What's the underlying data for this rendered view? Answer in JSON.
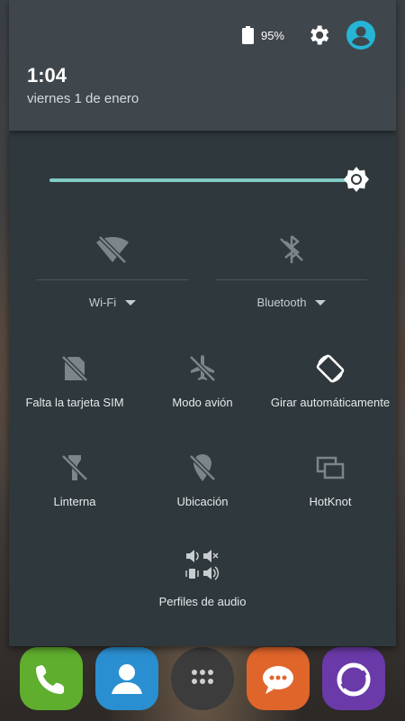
{
  "status": {
    "battery_percent": "95%",
    "battery_icon": "battery-icon",
    "settings_icon": "gear-icon",
    "user_icon": "account-icon"
  },
  "header": {
    "time": "1:04",
    "date": "viernes 1 de enero"
  },
  "brightness": {
    "level": 0.97,
    "icon": "brightness-icon"
  },
  "toggles": {
    "wifi": {
      "label": "Wi-Fi",
      "icon": "wifi-off-icon",
      "state": "off"
    },
    "bluetooth": {
      "label": "Bluetooth",
      "icon": "bluetooth-off-icon",
      "state": "off"
    }
  },
  "tiles": [
    {
      "label": "Falta la tarjeta SIM",
      "icon": "no-sim-icon"
    },
    {
      "label": "Modo avión",
      "icon": "airplane-icon"
    },
    {
      "label": "Girar automáticamente",
      "icon": "auto-rotate-icon"
    },
    {
      "label": "Linterna",
      "icon": "flashlight-icon"
    },
    {
      "label": "Ubicación",
      "icon": "location-off-icon"
    },
    {
      "label": "HotKnot",
      "icon": "hotknot-icon"
    },
    {
      "label": "Perfiles de audio",
      "icon": "audio-profiles-icon"
    }
  ],
  "dock": [
    {
      "name": "phone",
      "color": "#5fae2e"
    },
    {
      "name": "contacts",
      "color": "#2a8fd0"
    },
    {
      "name": "apps",
      "color": "#3c3c3c"
    },
    {
      "name": "messages",
      "color": "#e0652a"
    },
    {
      "name": "browser",
      "color": "#6a3aa8"
    }
  ]
}
